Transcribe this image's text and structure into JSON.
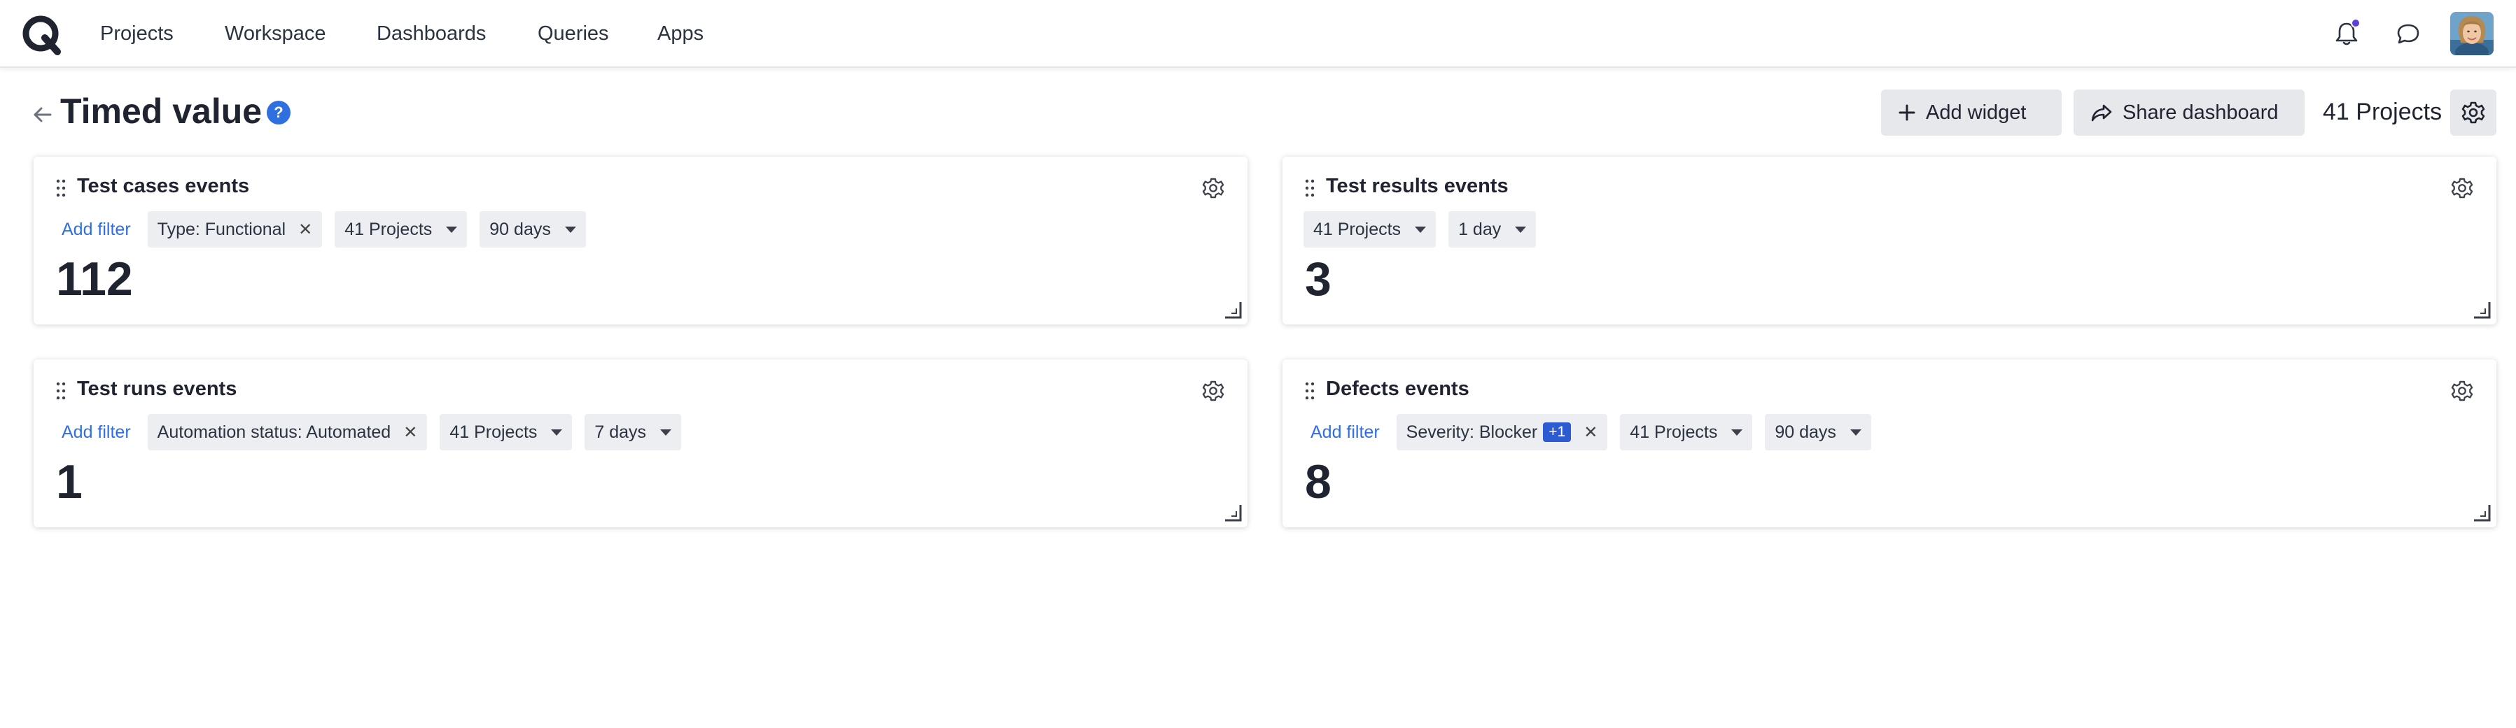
{
  "nav": {
    "items": [
      "Projects",
      "Workspace",
      "Dashboards",
      "Queries",
      "Apps"
    ]
  },
  "header": {
    "title": "Timed value",
    "help": "?",
    "add_widget": "Add widget",
    "share_dashboard": "Share dashboard",
    "projects_count": "41 Projects"
  },
  "widgets": [
    {
      "title": "Test cases events",
      "add_filter": "Add filter",
      "chips": [
        "Type: Functional",
        "41 Projects",
        "90 days"
      ],
      "value": "112"
    },
    {
      "title": "Test results events",
      "chips": [
        "41 Projects",
        "1 day"
      ],
      "value": "3"
    },
    {
      "title": "Test runs events",
      "add_filter": "Add filter",
      "chips": [
        "Automation status: Automated",
        "41 Projects",
        "7 days"
      ],
      "value": "1"
    },
    {
      "title": "Defects events",
      "add_filter": "Add filter",
      "chips": [
        "Severity: Blocker",
        "41 Projects",
        "90 days"
      ],
      "badge": "+1",
      "value": "8"
    }
  ],
  "colors": {
    "accent": "#2f6fe0",
    "notification_dot": "#5b3fd9",
    "button_bg": "#e6e8ec",
    "chip_bg": "#eceef1"
  },
  "icons": [
    "logo-icon",
    "bell-icon",
    "chat-icon",
    "back-arrow-icon",
    "help-icon",
    "plus-icon",
    "share-icon",
    "gear-icon",
    "drag-handle-icon",
    "close-icon",
    "caret-down-icon",
    "resize-handle-icon"
  ]
}
